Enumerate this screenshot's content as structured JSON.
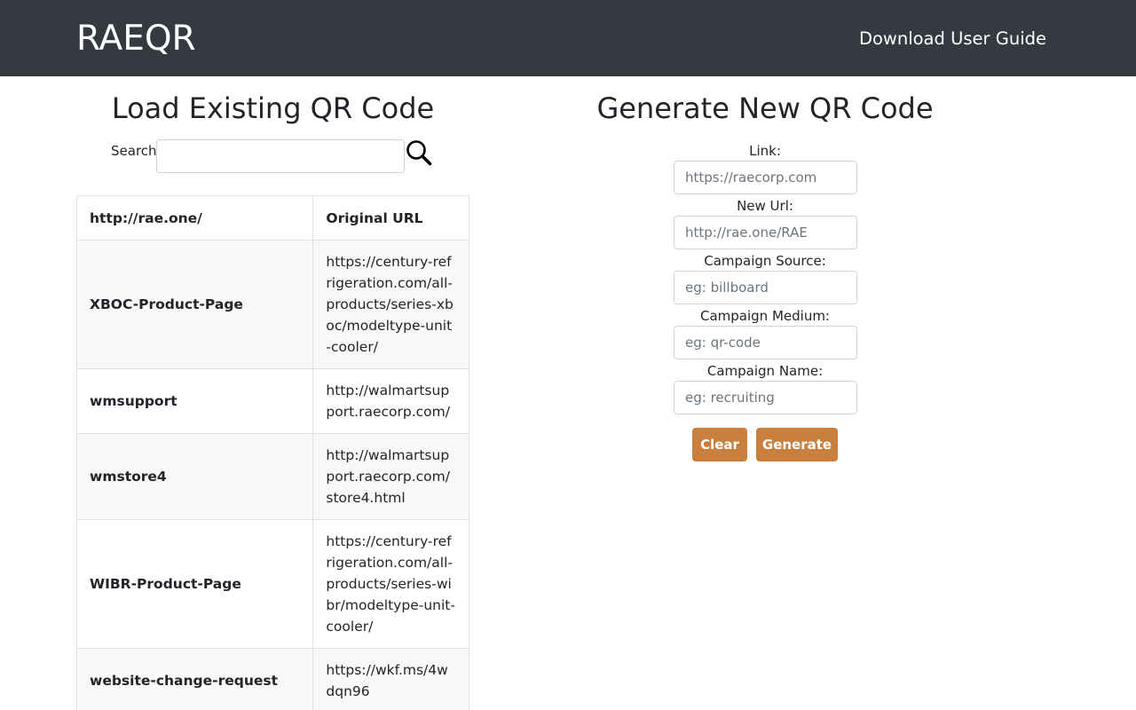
{
  "header": {
    "brand": "RAEQR",
    "guide_link": "Download User Guide"
  },
  "load_section": {
    "title": "Load Existing QR Code",
    "search_label": "Search:",
    "search_value": "",
    "search_icon": "magnifier-icon",
    "table": {
      "headers": [
        "http://rae.one/",
        "Original URL"
      ],
      "rows": [
        {
          "short": "XBOC-Product-Page",
          "original": "https://century-refrigeration.com/all-products/series-xboc/modeltype-unit-cooler/"
        },
        {
          "short": "wmsupport",
          "original": "http://walmartsupport.raecorp.com/"
        },
        {
          "short": "wmstore4",
          "original": "http://walmartsupport.raecorp.com/store4.html"
        },
        {
          "short": "WIBR-Product-Page",
          "original": "https://century-refrigeration.com/all-products/series-wibr/modeltype-unit-cooler/"
        },
        {
          "short": "website-change-request",
          "original": "https://wkf.ms/4wdqn96"
        }
      ]
    }
  },
  "generate_section": {
    "title": "Generate New QR Code",
    "fields": [
      {
        "label": "Link:",
        "placeholder": "https://raecorp.com"
      },
      {
        "label": "New Url:",
        "placeholder": "http://rae.one/RAE"
      },
      {
        "label": "Campaign Source:",
        "placeholder": "eg: billboard"
      },
      {
        "label": "Campaign Medium:",
        "placeholder": "eg: qr-code"
      },
      {
        "label": "Campaign Name:",
        "placeholder": "eg: recruiting"
      }
    ],
    "clear_label": "Clear",
    "generate_label": "Generate"
  },
  "colors": {
    "navbar": "#343a40",
    "button": "#c9803f",
    "stripe": "#f8f8f8"
  }
}
